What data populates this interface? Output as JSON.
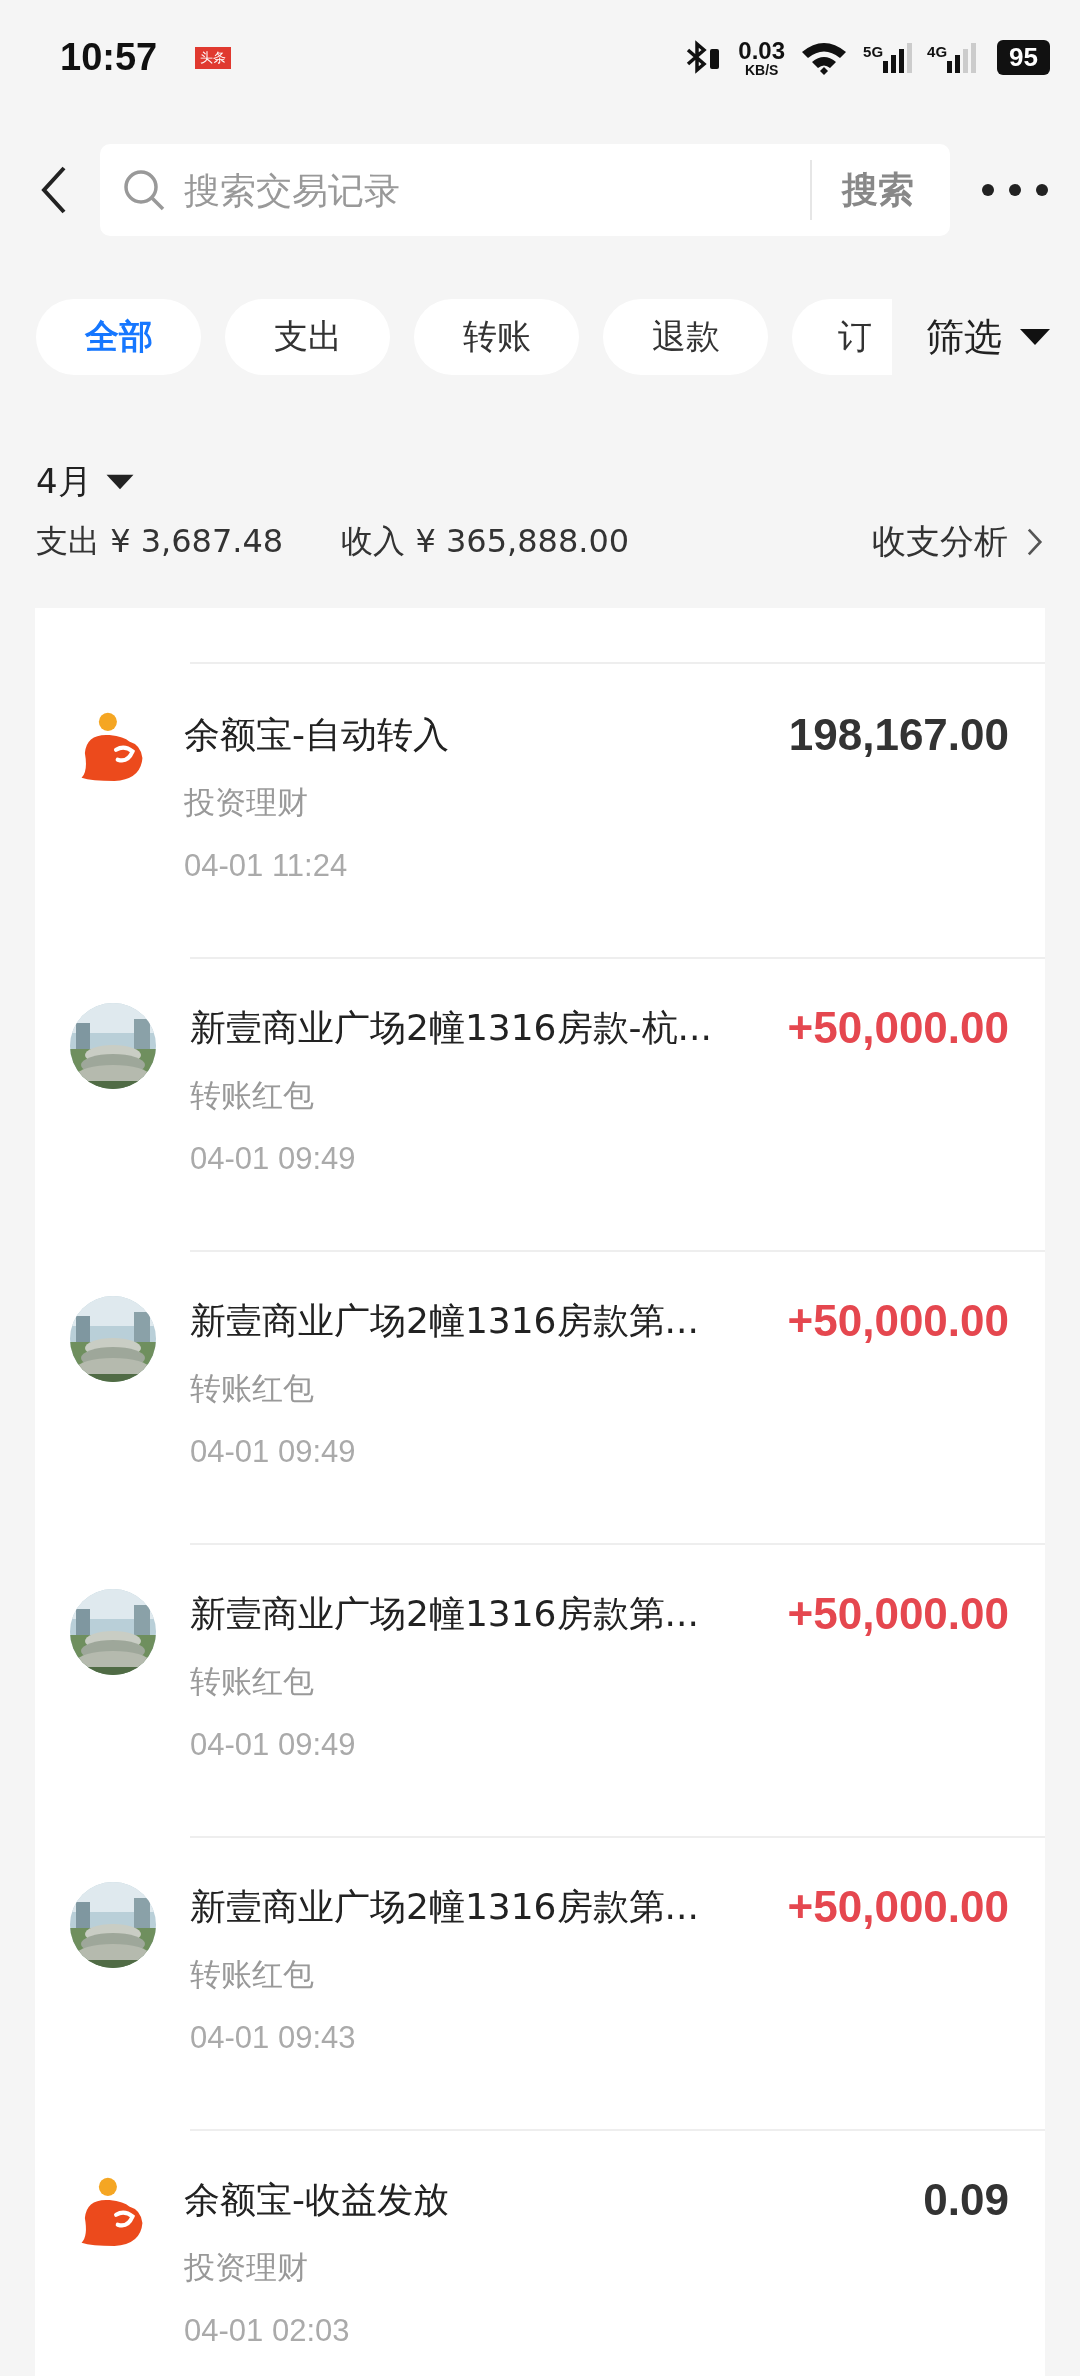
{
  "status_bar": {
    "time": "10:57",
    "badge": "头条",
    "speed": "0.03",
    "speed_unit": "KB/S",
    "network_1": "5G",
    "network_2": "4G",
    "battery": "95"
  },
  "search": {
    "placeholder": "搜索交易记录",
    "button": "搜索"
  },
  "filters": [
    {
      "label": "全部",
      "selected": true
    },
    {
      "label": "支出",
      "selected": false
    },
    {
      "label": "转账",
      "selected": false
    },
    {
      "label": "退款",
      "selected": false
    },
    {
      "label": "订",
      "selected": false
    }
  ],
  "filter_button": "筛选",
  "month": {
    "label": "4月",
    "expense": "支出 ¥ 3,687.48",
    "income": "收入 ¥ 365,888.00",
    "analysis": "收支分析"
  },
  "transactions": [
    {
      "title": "余额宝-自动转入",
      "category": "投资理财",
      "time": "04-01 11:24",
      "amount": "198,167.00",
      "kind": "fund"
    },
    {
      "title": "新壹商业广场2幢1316房款-杭...",
      "category": "转账红包",
      "time": "04-01 09:49",
      "amount": "+50,000.00",
      "kind": "transfer"
    },
    {
      "title": "新壹商业广场2幢1316房款第...",
      "category": "转账红包",
      "time": "04-01 09:49",
      "amount": "+50,000.00",
      "kind": "transfer"
    },
    {
      "title": "新壹商业广场2幢1316房款第...",
      "category": "转账红包",
      "time": "04-01 09:49",
      "amount": "+50,000.00",
      "kind": "transfer"
    },
    {
      "title": "新壹商业广场2幢1316房款第...",
      "category": "转账红包",
      "time": "04-01 09:43",
      "amount": "+50,000.00",
      "kind": "transfer"
    },
    {
      "title": "余额宝-收益发放",
      "category": "投资理财",
      "time": "04-01 02:03",
      "amount": "0.09",
      "kind": "fund"
    }
  ]
}
